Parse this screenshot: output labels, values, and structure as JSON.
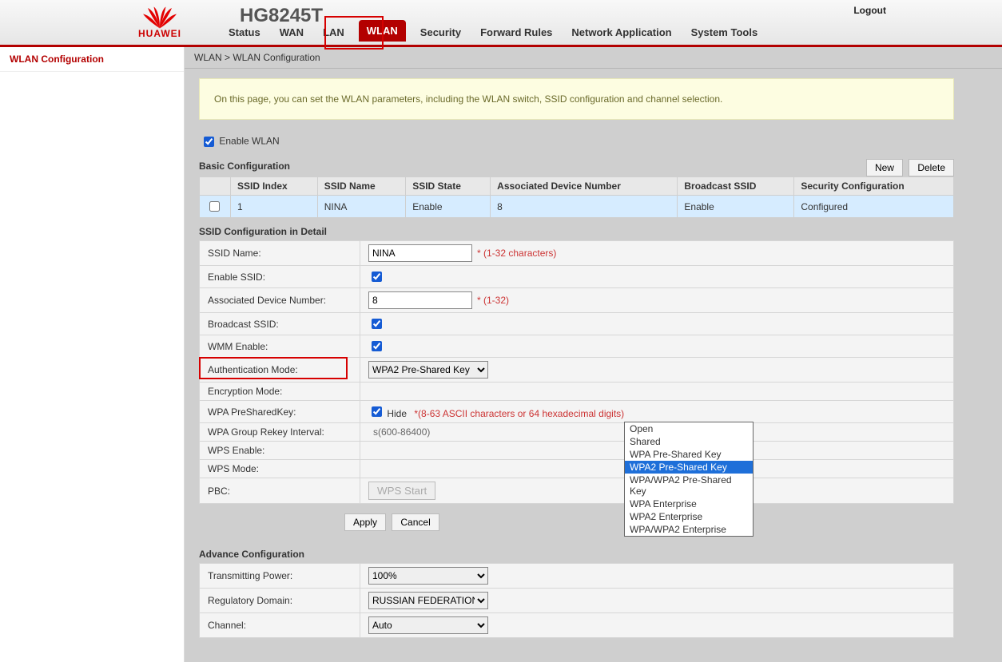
{
  "header": {
    "brand": "HUAWEI",
    "model": "HG8245T",
    "logout": "Logout",
    "nav": [
      "Status",
      "WAN",
      "LAN",
      "WLAN",
      "Security",
      "Forward Rules",
      "Network Application",
      "System Tools"
    ],
    "active": "WLAN"
  },
  "sidebar": {
    "items": [
      "WLAN Configuration"
    ]
  },
  "crumb": "WLAN > WLAN Configuration",
  "note": "On this page, you can set the WLAN parameters, including the WLAN switch, SSID configuration and channel selection.",
  "enable_wlan_label": "Enable WLAN",
  "basic": {
    "title": "Basic Configuration",
    "new": "New",
    "delete": "Delete",
    "cols": [
      "",
      "SSID Index",
      "SSID Name",
      "SSID State",
      "Associated Device Number",
      "Broadcast SSID",
      "Security Configuration"
    ],
    "rows": [
      {
        "idx": "1",
        "name": "NINA",
        "state": "Enable",
        "assoc": "8",
        "bcast": "Enable",
        "sec": "Configured"
      }
    ]
  },
  "detail": {
    "title": "SSID Configuration in Detail",
    "ssid_name_label": "SSID Name:",
    "ssid_name": "NINA",
    "ssid_hint": "* (1-32 characters)",
    "enable_ssid_label": "Enable SSID:",
    "assoc_label": "Associated Device Number:",
    "assoc": "8",
    "assoc_hint": "* (1-32)",
    "bcast_label": "Broadcast SSID:",
    "wmm_label": "WMM Enable:",
    "auth_label": "Authentication Mode:",
    "auth_value": "WPA2 Pre-Shared Key",
    "auth_options": [
      "Open",
      "Shared",
      "WPA Pre-Shared Key",
      "WPA2 Pre-Shared Key",
      "WPA/WPA2 Pre-Shared Key",
      "WPA Enterprise",
      "WPA2 Enterprise",
      "WPA/WPA2 Enterprise"
    ],
    "enc_label": "Encryption Mode:",
    "psk_label": "WPA PreSharedKey:",
    "psk_hide": "Hide",
    "psk_hint": "*(8-63 ASCII characters or 64 hexadecimal digits)",
    "rekey_label": "WPA Group Rekey Interval:",
    "rekey_hint": "s(600-86400)",
    "wps_enable_label": "WPS Enable:",
    "wps_mode_label": "WPS Mode:",
    "pbc_label": "PBC:",
    "wps_start": "WPS Start",
    "apply": "Apply",
    "cancel": "Cancel"
  },
  "adv": {
    "title": "Advance Configuration",
    "tx_label": "Transmitting Power:",
    "tx": "100%",
    "reg_label": "Regulatory Domain:",
    "reg": "RUSSIAN FEDERATION",
    "ch_label": "Channel:",
    "ch": "Auto"
  }
}
